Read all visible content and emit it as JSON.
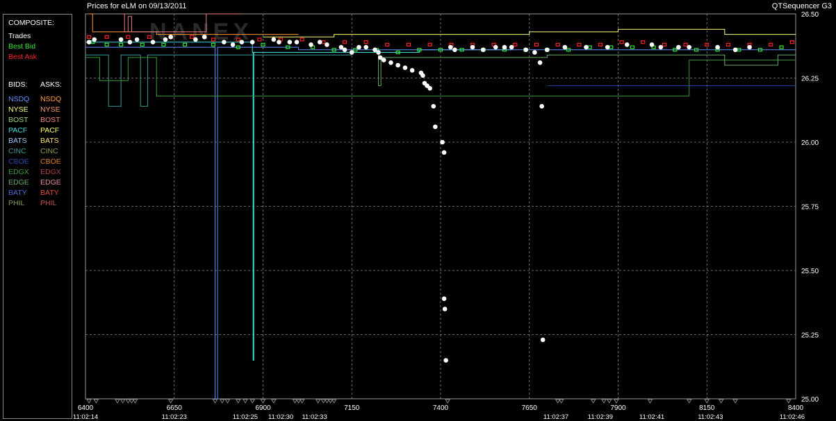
{
  "header": {
    "title": "Prices for  eLM  on  09/13/2011",
    "app_name": "QTSequencer G3"
  },
  "legend": {
    "composite_label": "COMPOSITE:",
    "composite_items": [
      {
        "label": "Trades",
        "color": "#ffffff"
      },
      {
        "label": "Best Bid",
        "color": "#2ee82e"
      },
      {
        "label": "Best Ask",
        "color": "#ff2020"
      }
    ],
    "bids_label": "BIDS:",
    "asks_label": "ASKS:",
    "exchanges": [
      {
        "bid": "NSDQ",
        "bid_color": "#5f8fff",
        "ask": "NSDQ",
        "ask_color": "#ff9a3c"
      },
      {
        "bid": "NYSE",
        "bid_color": "#ffff80",
        "ask": "NYSE",
        "ask_color": "#ff9a70"
      },
      {
        "bid": "BOST",
        "bid_color": "#9ad27a",
        "ask": "BOST",
        "ask_color": "#f08080"
      },
      {
        "bid": "PACF",
        "bid_color": "#40e0e0",
        "ask": "PACF",
        "ask_color": "#ffff60"
      },
      {
        "bid": "BATS",
        "bid_color": "#a8c8ff",
        "ask": "BATS",
        "ask_color": "#ffe070"
      },
      {
        "bid": "CINC",
        "bid_color": "#3a9a9a",
        "ask": "CINC",
        "ask_color": "#9a9a50"
      },
      {
        "bid": "CBOE",
        "bid_color": "#2a4aa8",
        "ask": "CBOE",
        "ask_color": "#e07a20"
      },
      {
        "bid": "EDGX",
        "bid_color": "#3a9a3a",
        "ask": "EDGX",
        "ask_color": "#b04040"
      },
      {
        "bid": "EDGE",
        "bid_color": "#6aaa6a",
        "ask": "EDGE",
        "ask_color": "#e09090"
      },
      {
        "bid": "BATY",
        "bid_color": "#4a6ad8",
        "ask": "BATY",
        "ask_color": "#e04a3a"
      },
      {
        "bid": "PHIL",
        "bid_color": "#7a9a5a",
        "ask": "PHIL",
        "ask_color": "#c05050"
      }
    ]
  },
  "chart_data": {
    "type": "scatter",
    "title": "Prices for  eLM  on  09/13/2011",
    "watermark": "NANEX",
    "xlim": [
      6400,
      8400
    ],
    "ylim": [
      25.0,
      26.5
    ],
    "x_ticks": [
      6400,
      6650,
      6900,
      7150,
      7400,
      7650,
      7900,
      8150,
      8400
    ],
    "y_ticks": [
      25.0,
      25.25,
      25.5,
      25.75,
      26.0,
      26.25,
      26.5
    ],
    "y_tick_labels": [
      "25.00",
      "25.25",
      "25.50",
      "25.75",
      "26.00",
      "26.25",
      "26.50"
    ],
    "grid": true,
    "time_labels": [
      {
        "x": 6400,
        "label": "11:02:14"
      },
      {
        "x": 6650,
        "label": "11:02:23"
      },
      {
        "x": 6850,
        "label": "11:02:25"
      },
      {
        "x": 6950,
        "label": "11:02:30"
      },
      {
        "x": 7045,
        "label": "11:02:33"
      },
      {
        "x": 7725,
        "label": "11:02:37"
      },
      {
        "x": 7850,
        "label": "11:02:39"
      },
      {
        "x": 7995,
        "label": "11:02:41"
      },
      {
        "x": 8160,
        "label": "11:02:43"
      },
      {
        "x": 8390,
        "label": "11:02:46"
      }
    ],
    "series": [
      {
        "name": "Trades",
        "color": "#ffffff",
        "points": [
          [
            6410,
            26.39
          ],
          [
            6425,
            26.4
          ],
          [
            6500,
            26.4
          ],
          [
            6525,
            26.39
          ],
          [
            6545,
            26.4
          ],
          [
            6590,
            26.39
          ],
          [
            6625,
            26.4
          ],
          [
            6640,
            26.41
          ],
          [
            6710,
            26.4
          ],
          [
            6735,
            26.41
          ],
          [
            6790,
            26.39
          ],
          [
            6815,
            26.38
          ],
          [
            6840,
            26.39
          ],
          [
            6870,
            26.39
          ],
          [
            6930,
            26.4
          ],
          [
            6945,
            26.39
          ],
          [
            6975,
            26.39
          ],
          [
            6995,
            26.39
          ],
          [
            7035,
            26.38
          ],
          [
            7060,
            26.39
          ],
          [
            7080,
            26.38
          ],
          [
            7120,
            26.37
          ],
          [
            7130,
            26.36
          ],
          [
            7150,
            26.35
          ],
          [
            7170,
            26.37
          ],
          [
            7190,
            26.37
          ],
          [
            7215,
            26.36
          ],
          [
            7225,
            26.35
          ],
          [
            7230,
            26.33
          ],
          [
            7240,
            26.32
          ],
          [
            7260,
            26.31
          ],
          [
            7280,
            26.3
          ],
          [
            7300,
            26.29
          ],
          [
            7320,
            26.28
          ],
          [
            7345,
            26.27
          ],
          [
            7350,
            26.26
          ],
          [
            7355,
            26.23
          ],
          [
            7362,
            26.22
          ],
          [
            7370,
            26.21
          ],
          [
            7380,
            26.14
          ],
          [
            7385,
            26.06
          ],
          [
            7405,
            26.0
          ],
          [
            7410,
            25.96
          ],
          [
            7410,
            25.39
          ],
          [
            7412,
            25.35
          ],
          [
            7415,
            25.15
          ],
          [
            7428,
            26.37
          ],
          [
            7440,
            26.36
          ],
          [
            7490,
            26.37
          ],
          [
            7520,
            26.36
          ],
          [
            7555,
            26.37
          ],
          [
            7580,
            26.37
          ],
          [
            7600,
            26.37
          ],
          [
            7640,
            26.36
          ],
          [
            7665,
            26.35
          ],
          [
            7680,
            26.31
          ],
          [
            7685,
            26.14
          ],
          [
            7688,
            25.23
          ],
          [
            7700,
            26.36
          ],
          [
            7750,
            26.37
          ],
          [
            7810,
            26.37
          ],
          [
            7870,
            26.37
          ],
          [
            7925,
            26.38
          ],
          [
            7995,
            26.38
          ],
          [
            8020,
            26.37
          ],
          [
            8070,
            26.37
          ],
          [
            8100,
            26.37
          ],
          [
            8180,
            26.37
          ],
          [
            8230,
            26.36
          ],
          [
            8270,
            26.37
          ]
        ]
      },
      {
        "name": "Best Bid",
        "color": "#2ee82e",
        "points": [
          [
            6420,
            26.39
          ],
          [
            6460,
            26.38
          ],
          [
            6500,
            26.38
          ],
          [
            6560,
            26.38
          ],
          [
            6620,
            26.38
          ],
          [
            6680,
            26.38
          ],
          [
            6760,
            26.38
          ],
          [
            6830,
            26.37
          ],
          [
            6900,
            26.38
          ],
          [
            6970,
            26.37
          ],
          [
            7040,
            26.37
          ],
          [
            7100,
            26.36
          ],
          [
            7160,
            26.36
          ],
          [
            7220,
            26.36
          ],
          [
            7280,
            26.35
          ],
          [
            7340,
            26.36
          ],
          [
            7400,
            26.36
          ],
          [
            7460,
            26.36
          ],
          [
            7520,
            26.36
          ],
          [
            7580,
            26.36
          ],
          [
            7640,
            26.36
          ],
          [
            7700,
            26.36
          ],
          [
            7760,
            26.36
          ],
          [
            7820,
            26.37
          ],
          [
            7880,
            26.37
          ],
          [
            7940,
            26.37
          ],
          [
            8000,
            26.37
          ],
          [
            8060,
            26.36
          ],
          [
            8120,
            26.36
          ],
          [
            8180,
            26.36
          ],
          [
            8240,
            26.36
          ],
          [
            8300,
            26.36
          ],
          [
            8360,
            26.37
          ]
        ]
      },
      {
        "name": "Best Ask",
        "color": "#ff2020",
        "points": [
          [
            6410,
            26.41
          ],
          [
            6460,
            26.41
          ],
          [
            6520,
            26.41
          ],
          [
            6580,
            26.41
          ],
          [
            6640,
            26.41
          ],
          [
            6700,
            26.41
          ],
          [
            6760,
            26.4
          ],
          [
            6830,
            26.4
          ],
          [
            6890,
            26.4
          ],
          [
            6950,
            26.4
          ],
          [
            7010,
            26.4
          ],
          [
            7070,
            26.39
          ],
          [
            7130,
            26.39
          ],
          [
            7190,
            26.39
          ],
          [
            7250,
            26.38
          ],
          [
            7310,
            26.38
          ],
          [
            7370,
            26.38
          ],
          [
            7430,
            26.38
          ],
          [
            7490,
            26.38
          ],
          [
            7550,
            26.38
          ],
          [
            7610,
            26.38
          ],
          [
            7670,
            26.38
          ],
          [
            7730,
            26.38
          ],
          [
            7790,
            26.38
          ],
          [
            7850,
            26.38
          ],
          [
            7910,
            26.39
          ],
          [
            7970,
            26.39
          ],
          [
            8030,
            26.38
          ],
          [
            8090,
            26.38
          ],
          [
            8150,
            26.38
          ],
          [
            8210,
            26.38
          ],
          [
            8270,
            26.38
          ],
          [
            8330,
            26.38
          ],
          [
            8390,
            26.39
          ]
        ]
      },
      {
        "name": "PACF",
        "color": "#40e0e0",
        "steps": [
          [
            6400,
            26.39
          ],
          [
            6600,
            26.39
          ],
          [
            6840,
            26.39
          ],
          [
            6870,
            26.35
          ],
          [
            6872,
            25.15
          ],
          [
            6874,
            26.35
          ],
          [
            7100,
            26.35
          ],
          [
            7340,
            26.36
          ],
          [
            7390,
            26.36
          ],
          [
            7400,
            26.36
          ],
          [
            7600,
            26.36
          ]
        ]
      },
      {
        "name": "NSDQ",
        "color": "#5f8fff",
        "steps": [
          [
            6400,
            26.37
          ],
          [
            6760,
            26.37
          ],
          [
            6765,
            25.0
          ],
          [
            6770,
            25.0
          ],
          [
            6772,
            26.37
          ],
          [
            7000,
            26.36
          ],
          [
            7500,
            26.36
          ],
          [
            8000,
            26.36
          ],
          [
            8400,
            26.36
          ]
        ]
      },
      {
        "name": "CINC",
        "color": "#3a9a9a",
        "steps": [
          [
            6400,
            26.34
          ],
          [
            6465,
            26.34
          ],
          [
            6465,
            26.14
          ],
          [
            6500,
            26.14
          ],
          [
            6500,
            26.34
          ],
          [
            6555,
            26.34
          ],
          [
            6555,
            26.14
          ],
          [
            6575,
            26.14
          ],
          [
            6575,
            26.34
          ],
          [
            6900,
            26.34
          ],
          [
            7150,
            26.34
          ]
        ]
      },
      {
        "name": "EDGX",
        "color": "#3a9a3a",
        "steps": [
          [
            6400,
            26.33
          ],
          [
            6440,
            26.33
          ],
          [
            6440,
            26.24
          ],
          [
            6520,
            26.24
          ],
          [
            6520,
            26.33
          ],
          [
            6600,
            26.33
          ],
          [
            6600,
            26.18
          ],
          [
            7500,
            26.18
          ],
          [
            7700,
            26.18
          ],
          [
            7700,
            26.18
          ],
          [
            7940,
            26.18
          ],
          [
            8100,
            26.18
          ],
          [
            8100,
            26.32
          ],
          [
            8400,
            26.32
          ]
        ]
      },
      {
        "name": "CBOE",
        "color": "#2a4aa8",
        "steps": [
          [
            7700,
            26.22
          ],
          [
            8400,
            26.22
          ]
        ]
      },
      {
        "name": "NYSE",
        "color": "#ffff80",
        "steps": [
          [
            6900,
            26.41
          ],
          [
            7100,
            26.41
          ],
          [
            7100,
            26.42
          ],
          [
            7600,
            26.42
          ],
          [
            7650,
            26.43
          ],
          [
            7900,
            26.43
          ],
          [
            7900,
            26.44
          ],
          [
            8200,
            26.44
          ],
          [
            8200,
            26.42
          ],
          [
            8400,
            26.42
          ]
        ]
      },
      {
        "name": "NSDQ ask",
        "color": "#ff9a3c",
        "steps": [
          [
            6410,
            26.5
          ],
          [
            6420,
            26.5
          ],
          [
            6420,
            26.43
          ],
          [
            6600,
            26.43
          ],
          [
            6600,
            26.42
          ],
          [
            7000,
            26.42
          ]
        ]
      },
      {
        "name": "BOST ask",
        "color": "#f08080",
        "steps": [
          [
            6500,
            26.5
          ],
          [
            6510,
            26.5
          ],
          [
            6510,
            26.43
          ],
          [
            6520,
            26.43
          ],
          [
            6520,
            26.49
          ],
          [
            6530,
            26.49
          ],
          [
            6530,
            26.43
          ],
          [
            6740,
            26.43
          ],
          [
            6740,
            26.5
          ],
          [
            6840,
            26.5
          ]
        ]
      },
      {
        "name": "EDGE",
        "color": "#6aaa6a",
        "steps": [
          [
            7220,
            26.35
          ],
          [
            7225,
            26.22
          ],
          [
            7230,
            26.22
          ],
          [
            7232,
            26.33
          ],
          [
            7700,
            26.34
          ],
          [
            8000,
            26.34
          ],
          [
            8200,
            26.34
          ],
          [
            8200,
            26.3
          ],
          [
            8350,
            26.3
          ],
          [
            8350,
            26.34
          ],
          [
            8400,
            26.34
          ]
        ]
      }
    ]
  }
}
